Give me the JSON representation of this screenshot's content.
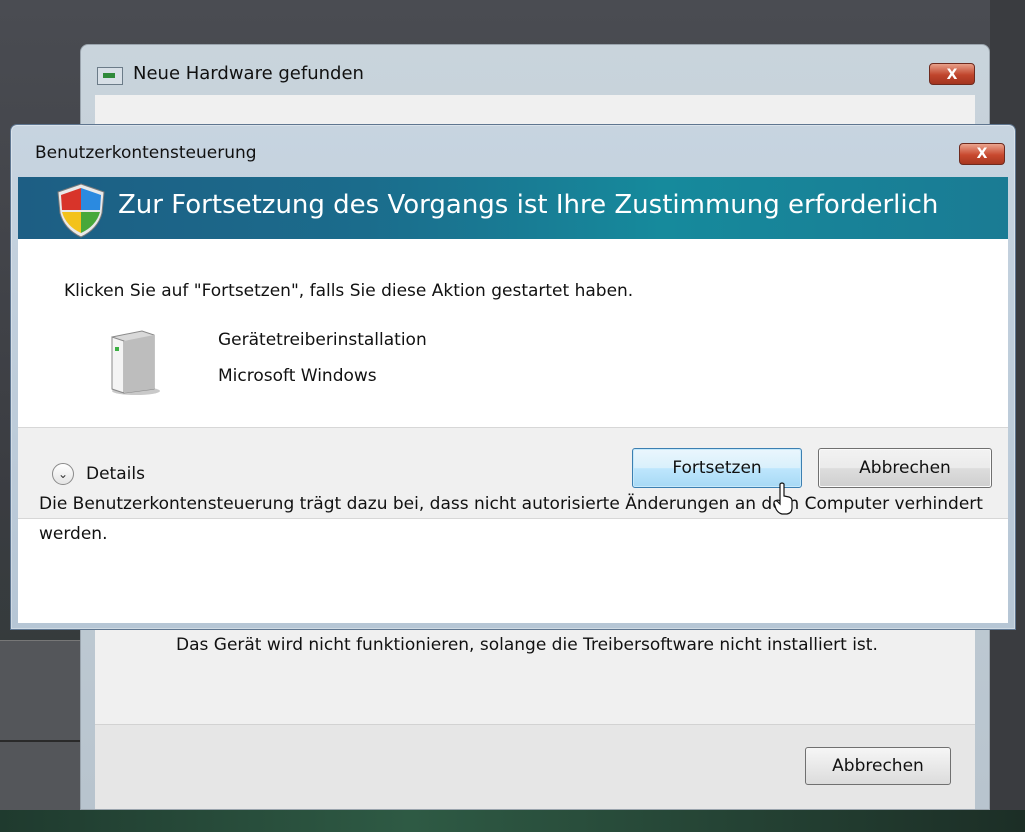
{
  "background_window": {
    "title": "Neue Hardware gefunden",
    "close_label": "X",
    "body_text": "Das Gerät wird nicht funktionieren, solange die Treibersoftware nicht installiert ist.",
    "cancel_label": "Abbrechen"
  },
  "uac_dialog": {
    "title": "Benutzerkontensteuerung",
    "close_label": "X",
    "banner_text": "Zur Fortsetzung des Vorgangs ist Ihre Zustimmung erforderlich",
    "question": "Klicken Sie auf \"Fortsetzen\", falls Sie diese Aktion gestartet haben.",
    "program_name": "Gerätetreiberinstallation",
    "publisher": "Microsoft Windows",
    "details_label": "Details",
    "continue_label": "Fortsetzen",
    "cancel_label": "Abbrechen",
    "info_text": "Die Benutzerkontensteuerung trägt dazu bei, dass nicht autorisierte Änderungen an dem Computer verhindert werden."
  },
  "icons": {
    "shield": "uac-shield-icon",
    "program": "computer-tower-icon",
    "details": "chevron-down-icon",
    "hardware": "hardware-wizard-icon"
  },
  "colors": {
    "banner": "#1b6c8c",
    "close": "#c8492f",
    "continue_button": "#bee6fd"
  }
}
